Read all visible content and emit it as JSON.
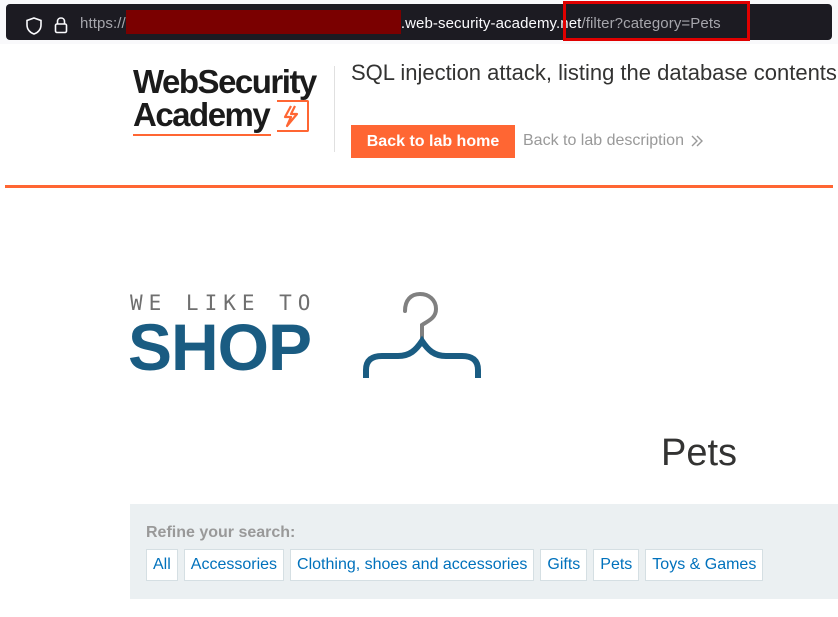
{
  "browser": {
    "url_scheme": "https://",
    "url_host_suffix": ".web-security-academy.net",
    "url_path": "/filter?category=Pets"
  },
  "header": {
    "logo_line1": "WebSecurity",
    "logo_line2": "Academy",
    "lab_title": "SQL injection attack, listing the database contents on non-Oracle databases",
    "back_button": "Back to lab home",
    "description_link": "Back to lab description"
  },
  "shop": {
    "tagline": "WE LIKE TO",
    "brand": "SHOP",
    "brand_color": "#1a5c82",
    "accent_color": "#ff6633"
  },
  "main": {
    "page_title": "Pets",
    "refine_label": "Refine your search:",
    "categories": [
      "All",
      "Accessories",
      "Clothing, shoes and accessories",
      "Gifts",
      "Pets",
      "Toys & Games"
    ]
  }
}
